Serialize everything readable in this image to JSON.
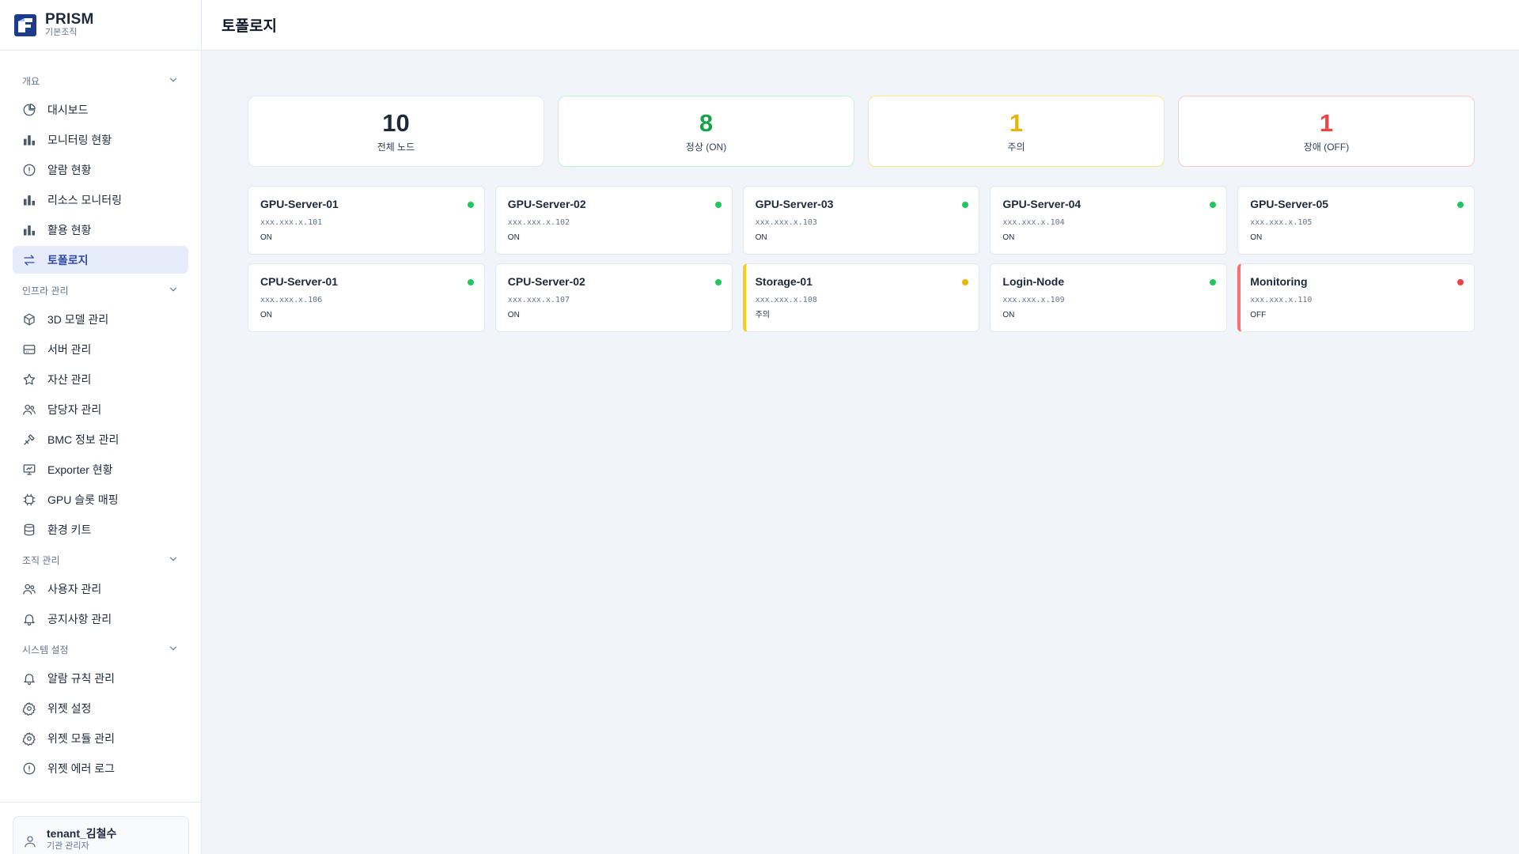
{
  "brand": {
    "name": "PRISM",
    "subtitle": "기본조직"
  },
  "header": {
    "title": "토폴로지"
  },
  "colors": {
    "accent": "#2f4aa8",
    "on": "#22c55e",
    "warn": "#eab308",
    "off": "#ef4444",
    "total": "#1e293b"
  },
  "sidebar": {
    "sections": [
      {
        "title": "개요",
        "items": [
          {
            "label": "대시보드",
            "icon": "pie-chart-icon"
          },
          {
            "label": "모니터링 현황",
            "icon": "bar-chart-icon"
          },
          {
            "label": "알람 현황",
            "icon": "alert-circle-icon"
          },
          {
            "label": "리소스 모니터링",
            "icon": "bar-chart-icon"
          },
          {
            "label": "활용 현황",
            "icon": "bar-chart-icon"
          },
          {
            "label": "토폴로지",
            "icon": "arrows-exchange-icon",
            "active": true
          }
        ]
      },
      {
        "title": "인프라 관리",
        "items": [
          {
            "label": "3D 모델 관리",
            "icon": "cube-icon"
          },
          {
            "label": "서버 관리",
            "icon": "hard-drive-icon"
          },
          {
            "label": "자산 관리",
            "icon": "star-icon"
          },
          {
            "label": "담당자 관리",
            "icon": "users-icon"
          },
          {
            "label": "BMC 정보 관리",
            "icon": "tools-icon"
          },
          {
            "label": "Exporter 현황",
            "icon": "presentation-icon"
          },
          {
            "label": "GPU 슬롯 매핑",
            "icon": "chip-icon"
          },
          {
            "label": "환경 키트",
            "icon": "database-icon"
          }
        ]
      },
      {
        "title": "조직 관리",
        "items": [
          {
            "label": "사용자 관리",
            "icon": "users-icon"
          },
          {
            "label": "공지사항 관리",
            "icon": "bell-icon"
          }
        ]
      },
      {
        "title": "시스템 설정",
        "items": [
          {
            "label": "알람 규칙 관리",
            "icon": "bell-icon"
          },
          {
            "label": "위젯 설정",
            "icon": "gear-icon"
          },
          {
            "label": "위젯 모듈 관리",
            "icon": "gear-icon"
          },
          {
            "label": "위젯 에러 로그",
            "icon": "alert-circle-icon"
          }
        ]
      }
    ]
  },
  "user": {
    "name": "tenant_김철수",
    "role": "기관 관리자"
  },
  "summary": [
    {
      "value": "10",
      "label": "전체 노드",
      "tone": "total"
    },
    {
      "value": "8",
      "label": "정상 (ON)",
      "tone": "green"
    },
    {
      "value": "1",
      "label": "주의",
      "tone": "yellow"
    },
    {
      "value": "1",
      "label": "장애 (OFF)",
      "tone": "red"
    }
  ],
  "nodes": [
    {
      "name": "GPU-Server-01",
      "ip": "xxx.xxx.x.101",
      "status": "ON",
      "state": "on"
    },
    {
      "name": "GPU-Server-02",
      "ip": "xxx.xxx.x.102",
      "status": "ON",
      "state": "on"
    },
    {
      "name": "GPU-Server-03",
      "ip": "xxx.xxx.x.103",
      "status": "ON",
      "state": "on"
    },
    {
      "name": "GPU-Server-04",
      "ip": "xxx.xxx.x.104",
      "status": "ON",
      "state": "on"
    },
    {
      "name": "GPU-Server-05",
      "ip": "xxx.xxx.x.105",
      "status": "ON",
      "state": "on"
    },
    {
      "name": "CPU-Server-01",
      "ip": "xxx.xxx.x.106",
      "status": "ON",
      "state": "on"
    },
    {
      "name": "CPU-Server-02",
      "ip": "xxx.xxx.x.107",
      "status": "ON",
      "state": "on"
    },
    {
      "name": "Storage-01",
      "ip": "xxx.xxx.x.108",
      "status": "주의",
      "state": "warn"
    },
    {
      "name": "Login-Node",
      "ip": "xxx.xxx.x.109",
      "status": "ON",
      "state": "on"
    },
    {
      "name": "Monitoring",
      "ip": "xxx.xxx.x.110",
      "status": "OFF",
      "state": "err"
    }
  ]
}
